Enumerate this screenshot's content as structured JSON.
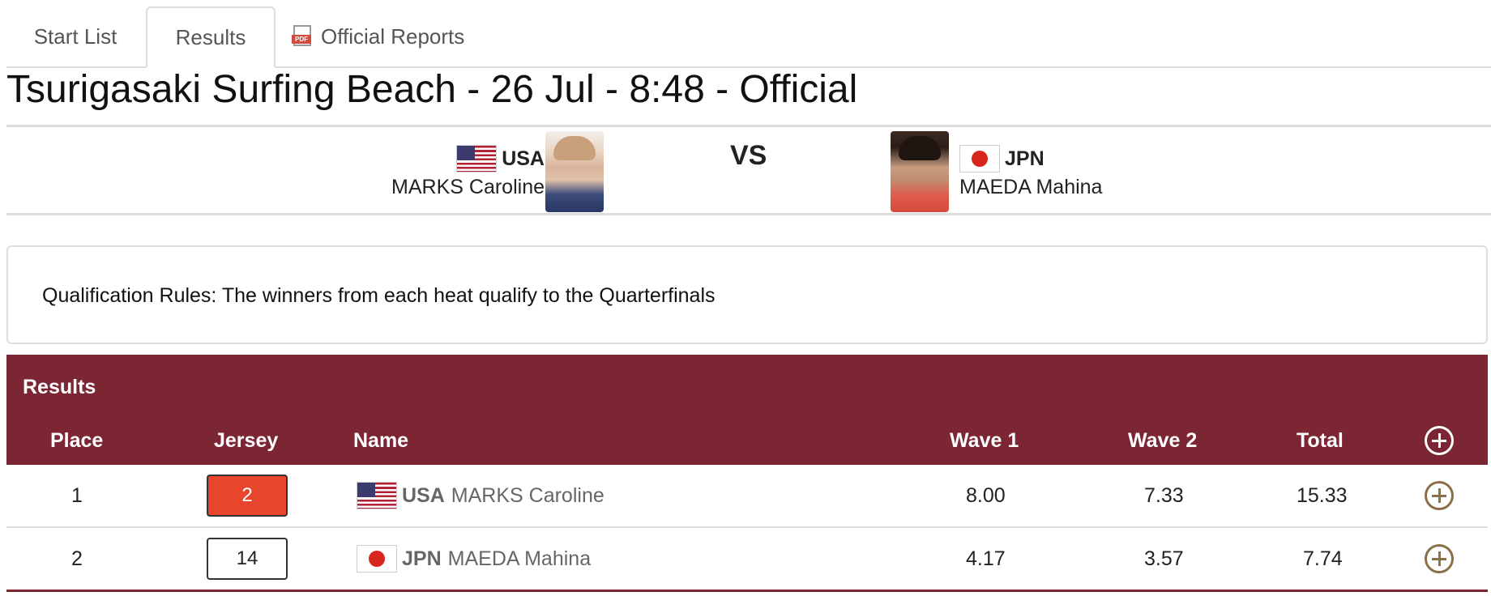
{
  "tabs": {
    "start_list": "Start List",
    "results": "Results",
    "official_reports": "Official Reports"
  },
  "page_title": "Tsurigasaki Surfing Beach - 26 Jul - 8:48 - Official",
  "matchup": {
    "vs_label": "VS",
    "left": {
      "noc": "USA",
      "name": "MARKS Caroline",
      "flag_icon": "usa-flag-icon"
    },
    "right": {
      "noc": "JPN",
      "name": "MAEDA Mahina",
      "flag_icon": "japan-flag-icon"
    }
  },
  "qualification": {
    "text": "Qualification Rules: The winners from each heat qualify to the Quarterfinals"
  },
  "results": {
    "title": "Results",
    "columns": {
      "place": "Place",
      "jersey": "Jersey",
      "name": "Name",
      "wave1": "Wave 1",
      "wave2": "Wave 2",
      "total": "Total"
    },
    "rows": [
      {
        "place": "1",
        "jersey": "2",
        "jersey_color": "#e8452d",
        "noc": "USA",
        "name": "MARKS Caroline",
        "wave1": "8.00",
        "wave2": "7.33",
        "total": "15.33"
      },
      {
        "place": "2",
        "jersey": "14",
        "jersey_color": "#ffffff",
        "noc": "JPN",
        "name": "MAEDA Mahina",
        "wave1": "4.17",
        "wave2": "3.57",
        "total": "7.74"
      }
    ]
  },
  "colors": {
    "header_bg": "#7d2633",
    "expand_icon": "#8b6f47"
  }
}
